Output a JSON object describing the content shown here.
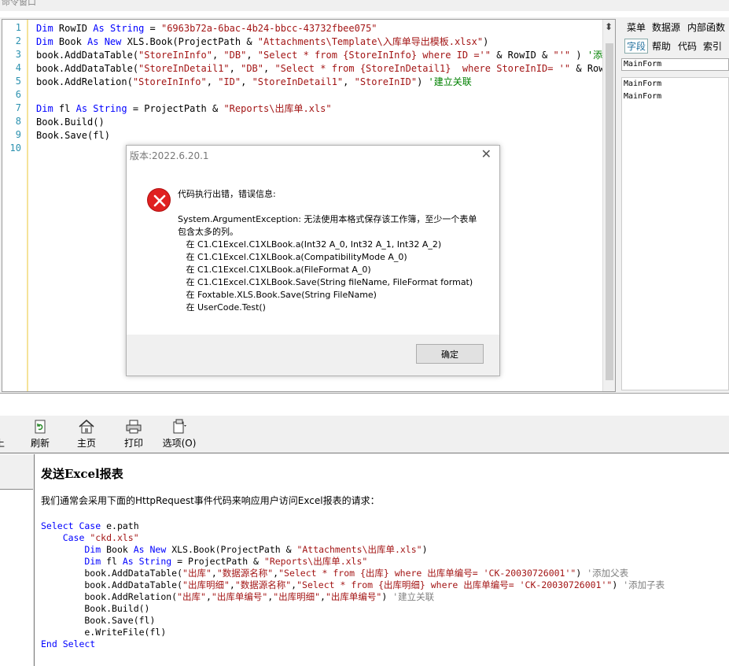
{
  "window_title": "命令窗口",
  "editor": {
    "line_numbers": [
      "1",
      "2",
      "3",
      "4",
      "5",
      "6",
      "7",
      "8",
      "9",
      "10"
    ],
    "lines": [
      [
        {
          "t": "kw",
          "v": "Dim "
        },
        {
          "t": "tx",
          "v": "RowID "
        },
        {
          "t": "kw",
          "v": "As String"
        },
        {
          "t": "tx",
          "v": " = "
        },
        {
          "t": "str",
          "v": "\"6963b72a-6bac-4b24-bbcc-43732fbee075\""
        }
      ],
      [
        {
          "t": "kw",
          "v": "Dim "
        },
        {
          "t": "tx",
          "v": "Book "
        },
        {
          "t": "kw",
          "v": "As New"
        },
        {
          "t": "tx",
          "v": " XLS.Book(ProjectPath & "
        },
        {
          "t": "str",
          "v": "\"Attachments\\Template\\入库单导出模板.xlsx\""
        },
        {
          "t": "tx",
          "v": ")"
        }
      ],
      [
        {
          "t": "tx",
          "v": "book.AddDataTable("
        },
        {
          "t": "str",
          "v": "\"StoreInInfo\""
        },
        {
          "t": "tx",
          "v": ", "
        },
        {
          "t": "str",
          "v": "\"DB\""
        },
        {
          "t": "tx",
          "v": ", "
        },
        {
          "t": "str",
          "v": "\"Select * from {StoreInInfo} where ID ='\""
        },
        {
          "t": "tx",
          "v": " & RowID & "
        },
        {
          "t": "str",
          "v": "\"'\""
        },
        {
          "t": "tx",
          "v": " ) "
        },
        {
          "t": "cm",
          "v": "'添加主"
        }
      ],
      [
        {
          "t": "tx",
          "v": "book.AddDataTable("
        },
        {
          "t": "str",
          "v": "\"StoreInDetail1\""
        },
        {
          "t": "tx",
          "v": ", "
        },
        {
          "t": "str",
          "v": "\"DB\""
        },
        {
          "t": "tx",
          "v": ", "
        },
        {
          "t": "str",
          "v": "\"Select * from {StoreInDetail1}  where StoreInID= '\""
        },
        {
          "t": "tx",
          "v": " & RowID"
        }
      ],
      [
        {
          "t": "tx",
          "v": "book.AddRelation("
        },
        {
          "t": "str",
          "v": "\"StoreInInfo\""
        },
        {
          "t": "tx",
          "v": ", "
        },
        {
          "t": "str",
          "v": "\"ID\""
        },
        {
          "t": "tx",
          "v": ", "
        },
        {
          "t": "str",
          "v": "\"StoreInDetail1\""
        },
        {
          "t": "tx",
          "v": ", "
        },
        {
          "t": "str",
          "v": "\"StoreInID\""
        },
        {
          "t": "tx",
          "v": ") "
        },
        {
          "t": "cm",
          "v": "'建立关联"
        }
      ],
      [],
      [
        {
          "t": "kw",
          "v": "Dim "
        },
        {
          "t": "tx",
          "v": "fl "
        },
        {
          "t": "kw",
          "v": "As String"
        },
        {
          "t": "tx",
          "v": " = ProjectPath & "
        },
        {
          "t": "str",
          "v": "\"Reports\\出库单.xls\""
        }
      ],
      [
        {
          "t": "tx",
          "v": "Book.Build()"
        }
      ],
      [
        {
          "t": "tx",
          "v": "Book.Save(fl)"
        }
      ],
      []
    ]
  },
  "side_panel": {
    "tabs_row1": [
      "菜单",
      "数据源",
      "内部函数"
    ],
    "tabs_row2": [
      "字段",
      "帮助",
      "代码",
      "索引"
    ],
    "active_tab": "字段",
    "input_value": "MainForm",
    "list_items": [
      "MainForm",
      "MainForm"
    ]
  },
  "dialog": {
    "title": "版本:2022.6.20.1",
    "close_glyph": "✕",
    "message_lines": [
      "代码执行出错，错误信息:",
      "",
      "System.ArgumentException: 无法使用本格式保存该工作簿，至少一个表单",
      "包含太多的列。",
      "   在 C1.C1Excel.C1XLBook.a(Int32 A_0, Int32 A_1, Int32 A_2)",
      "   在 C1.C1Excel.C1XLBook.a(CompatibilityMode A_0)",
      "   在 C1.C1Excel.C1XLBook.a(FileFormat A_0)",
      "   在 C1.C1Excel.C1XLBook.Save(String fileName, FileFormat format)",
      "   在 Foxtable.XLS.Book.Save(String FileName)",
      "   在 UserCode.Test()"
    ],
    "ok_label": "确定",
    "icon": "error-icon",
    "icon_color": "#e02020"
  },
  "toolbar": {
    "partial_label": "上",
    "refresh_label": "刷新",
    "home_label": "主页",
    "print_label": "打印",
    "options_label": "选项(O)"
  },
  "doc": {
    "title": "发送Excel报表",
    "intro": "我们通常会采用下面的HttpRequest事件代码来响应用户访问Excel报表的请求：",
    "code_lines": [
      [
        {
          "t": "kw",
          "v": "Select Case"
        },
        {
          "t": "tx",
          "v": " e.path"
        }
      ],
      [
        {
          "t": "tx",
          "v": "    "
        },
        {
          "t": "kw",
          "v": "Case "
        },
        {
          "t": "str",
          "v": "\"ckd.xls\""
        }
      ],
      [
        {
          "t": "tx",
          "v": "        "
        },
        {
          "t": "kw",
          "v": "Dim "
        },
        {
          "t": "tx",
          "v": "Book "
        },
        {
          "t": "kw",
          "v": "As New"
        },
        {
          "t": "tx",
          "v": " XLS.Book(ProjectPath & "
        },
        {
          "t": "str",
          "v": "\"Attachments\\出库单.xls\""
        },
        {
          "t": "tx",
          "v": ")"
        }
      ],
      [
        {
          "t": "tx",
          "v": "        "
        },
        {
          "t": "kw",
          "v": "Dim "
        },
        {
          "t": "tx",
          "v": "fl "
        },
        {
          "t": "kw",
          "v": "As String"
        },
        {
          "t": "tx",
          "v": " = ProjectPath & "
        },
        {
          "t": "str",
          "v": "\"Reports\\出库单.xls\""
        }
      ],
      [
        {
          "t": "tx",
          "v": "        book.AddDataTable("
        },
        {
          "t": "str",
          "v": "\"出库\""
        },
        {
          "t": "tx",
          "v": ","
        },
        {
          "t": "str",
          "v": "\"数据源名称\""
        },
        {
          "t": "tx",
          "v": ","
        },
        {
          "t": "str",
          "v": "\"Select * from {出库} where 出库单编号= 'CK-20030726001'\""
        },
        {
          "t": "tx",
          "v": ") "
        },
        {
          "t": "cm",
          "v": "'添加父表"
        }
      ],
      [
        {
          "t": "tx",
          "v": "        book.AddDataTable("
        },
        {
          "t": "str",
          "v": "\"出库明细\""
        },
        {
          "t": "tx",
          "v": ","
        },
        {
          "t": "str",
          "v": "\"数据源名称\""
        },
        {
          "t": "tx",
          "v": ","
        },
        {
          "t": "str",
          "v": "\"Select * from {出库明细} where 出库单编号= 'CK-20030726001'\""
        },
        {
          "t": "tx",
          "v": ") "
        },
        {
          "t": "cm",
          "v": "'添加子表"
        }
      ],
      [
        {
          "t": "tx",
          "v": "        book.AddRelation("
        },
        {
          "t": "str",
          "v": "\"出库\""
        },
        {
          "t": "tx",
          "v": ","
        },
        {
          "t": "str",
          "v": "\"出库单编号\""
        },
        {
          "t": "tx",
          "v": ","
        },
        {
          "t": "str",
          "v": "\"出库明细\""
        },
        {
          "t": "tx",
          "v": ","
        },
        {
          "t": "str",
          "v": "\"出库单编号\""
        },
        {
          "t": "tx",
          "v": ") "
        },
        {
          "t": "cm",
          "v": "'建立关联"
        }
      ],
      [
        {
          "t": "tx",
          "v": "        Book.Build()"
        }
      ],
      [
        {
          "t": "tx",
          "v": "        Book.Save(fl)"
        }
      ],
      [
        {
          "t": "tx",
          "v": "        e.WriteFile(fl)"
        }
      ],
      [
        {
          "t": "kw",
          "v": "End Select"
        }
      ]
    ]
  }
}
